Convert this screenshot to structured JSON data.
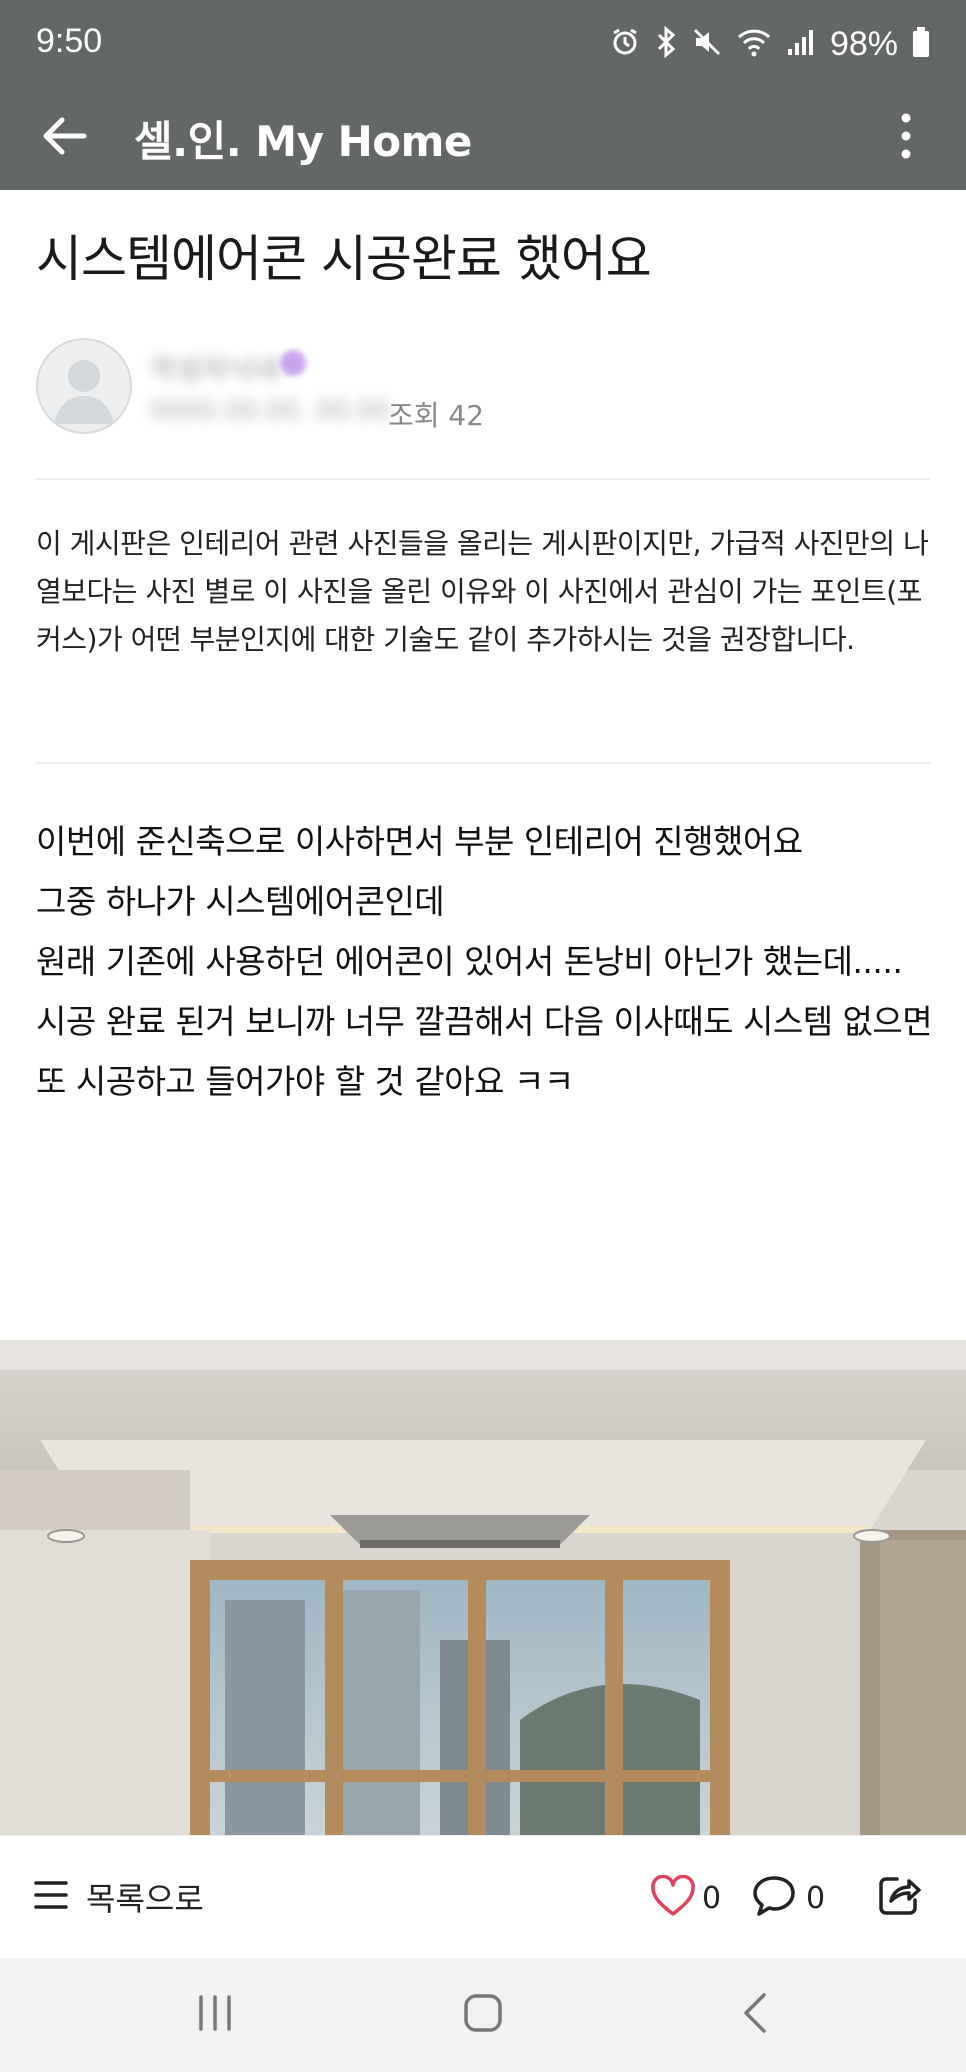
{
  "status_bar": {
    "time": "9:50",
    "battery": "98%",
    "icons": [
      "alarm-icon",
      "bluetooth-icon",
      "mute-icon",
      "wifi-icon",
      "signal-icon",
      "battery-icon"
    ]
  },
  "app_bar": {
    "title": "셀.인. My Home",
    "back_icon": "arrow-left-icon",
    "more_icon": "more-vertical-icon",
    "background": "#646768"
  },
  "post": {
    "title": "시스템에어콘 시공완료 했어요",
    "views": "조회 42",
    "notice": "이 게시판은 인테리어 관련 사진들을 올리는 게시판이지만, 가급적 사진만의 나열보다는 사진 별로 이 사진을 올린 이유와 이 사진에서 관심이 가는 포인트(포커스)가 어떤 부분인지에 대한 기술도 같이 추가하시는 것을 권장합니다.",
    "body_lines": [
      "이번에 준신축으로 이사하면서 부분 인테리어 진행했어요",
      "그중 하나가 시스템에어콘인데",
      "원래 기존에 사용하던 에어콘이 있어서 돈낭비 아닌가 했는데.....",
      "시공 완료 된거 보니까 너무 깔끔해서 다음 이사때도 시스템 없으면",
      "또 시공하고 들어가야 할 것 같아요 ㅋㅋ"
    ]
  },
  "bottom_bar": {
    "list_label": "목록으로",
    "like_count": "0",
    "comment_count": "0",
    "like_color": "#e0405a"
  },
  "nav_bar": {
    "icons": [
      "recent-apps-icon",
      "home-icon",
      "back-nav-icon"
    ]
  }
}
